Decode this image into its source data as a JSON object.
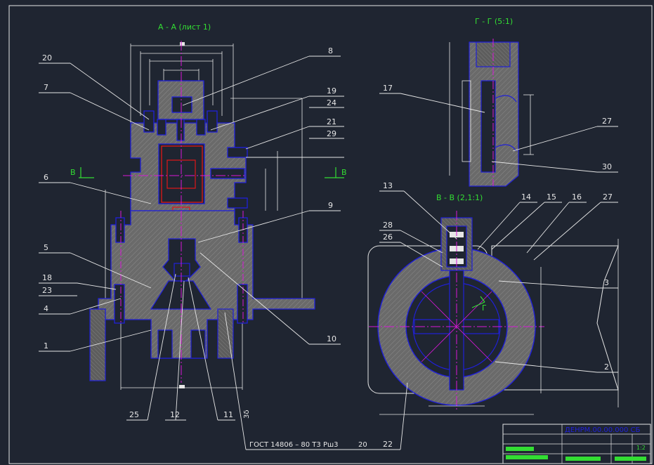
{
  "titles": {
    "section_aa": "А - А (лист 1)",
    "section_gg": "Г - Г (5:1)",
    "section_vv": "В - В (2,1:1)"
  },
  "cut_marks": {
    "v_left": "В",
    "v_right": "В",
    "g": "Г"
  },
  "callouts": {
    "n20": "20",
    "n7": "7",
    "n6": "6",
    "n5": "5",
    "n18": "18",
    "n23": "23",
    "n4": "4",
    "n1": "1",
    "n8": "8",
    "n19": "19",
    "n24": "24",
    "n21": "21",
    "n29": "29",
    "n9": "9",
    "n10": "10",
    "n25": "25",
    "n12": "12",
    "n11": "11",
    "n17": "17",
    "n27a": "27",
    "n30": "30",
    "n13": "13",
    "n14": "14",
    "n15": "15",
    "n16": "16",
    "n27b": "27",
    "n28": "28",
    "n26": "26",
    "n3": "3",
    "n2": "2",
    "n22": "22"
  },
  "notes": {
    "weld_standard": "ГОСТ 14806 – 80  Т3  Рш3",
    "weld_size": "20",
    "surface": "3δ"
  },
  "title_block": {
    "doc_code": "ДЕНРМ.00.00.000 СБ",
    "scale": "1:2"
  },
  "colors": {
    "background": "#1f2531",
    "outline": "#2020d8",
    "section_fill": "#6e6e6e",
    "leader": "#ffffff",
    "title_text": "#33dd33",
    "axis": "#d818d8",
    "highlight": "#e01818",
    "frame": "#e6e6e6"
  }
}
